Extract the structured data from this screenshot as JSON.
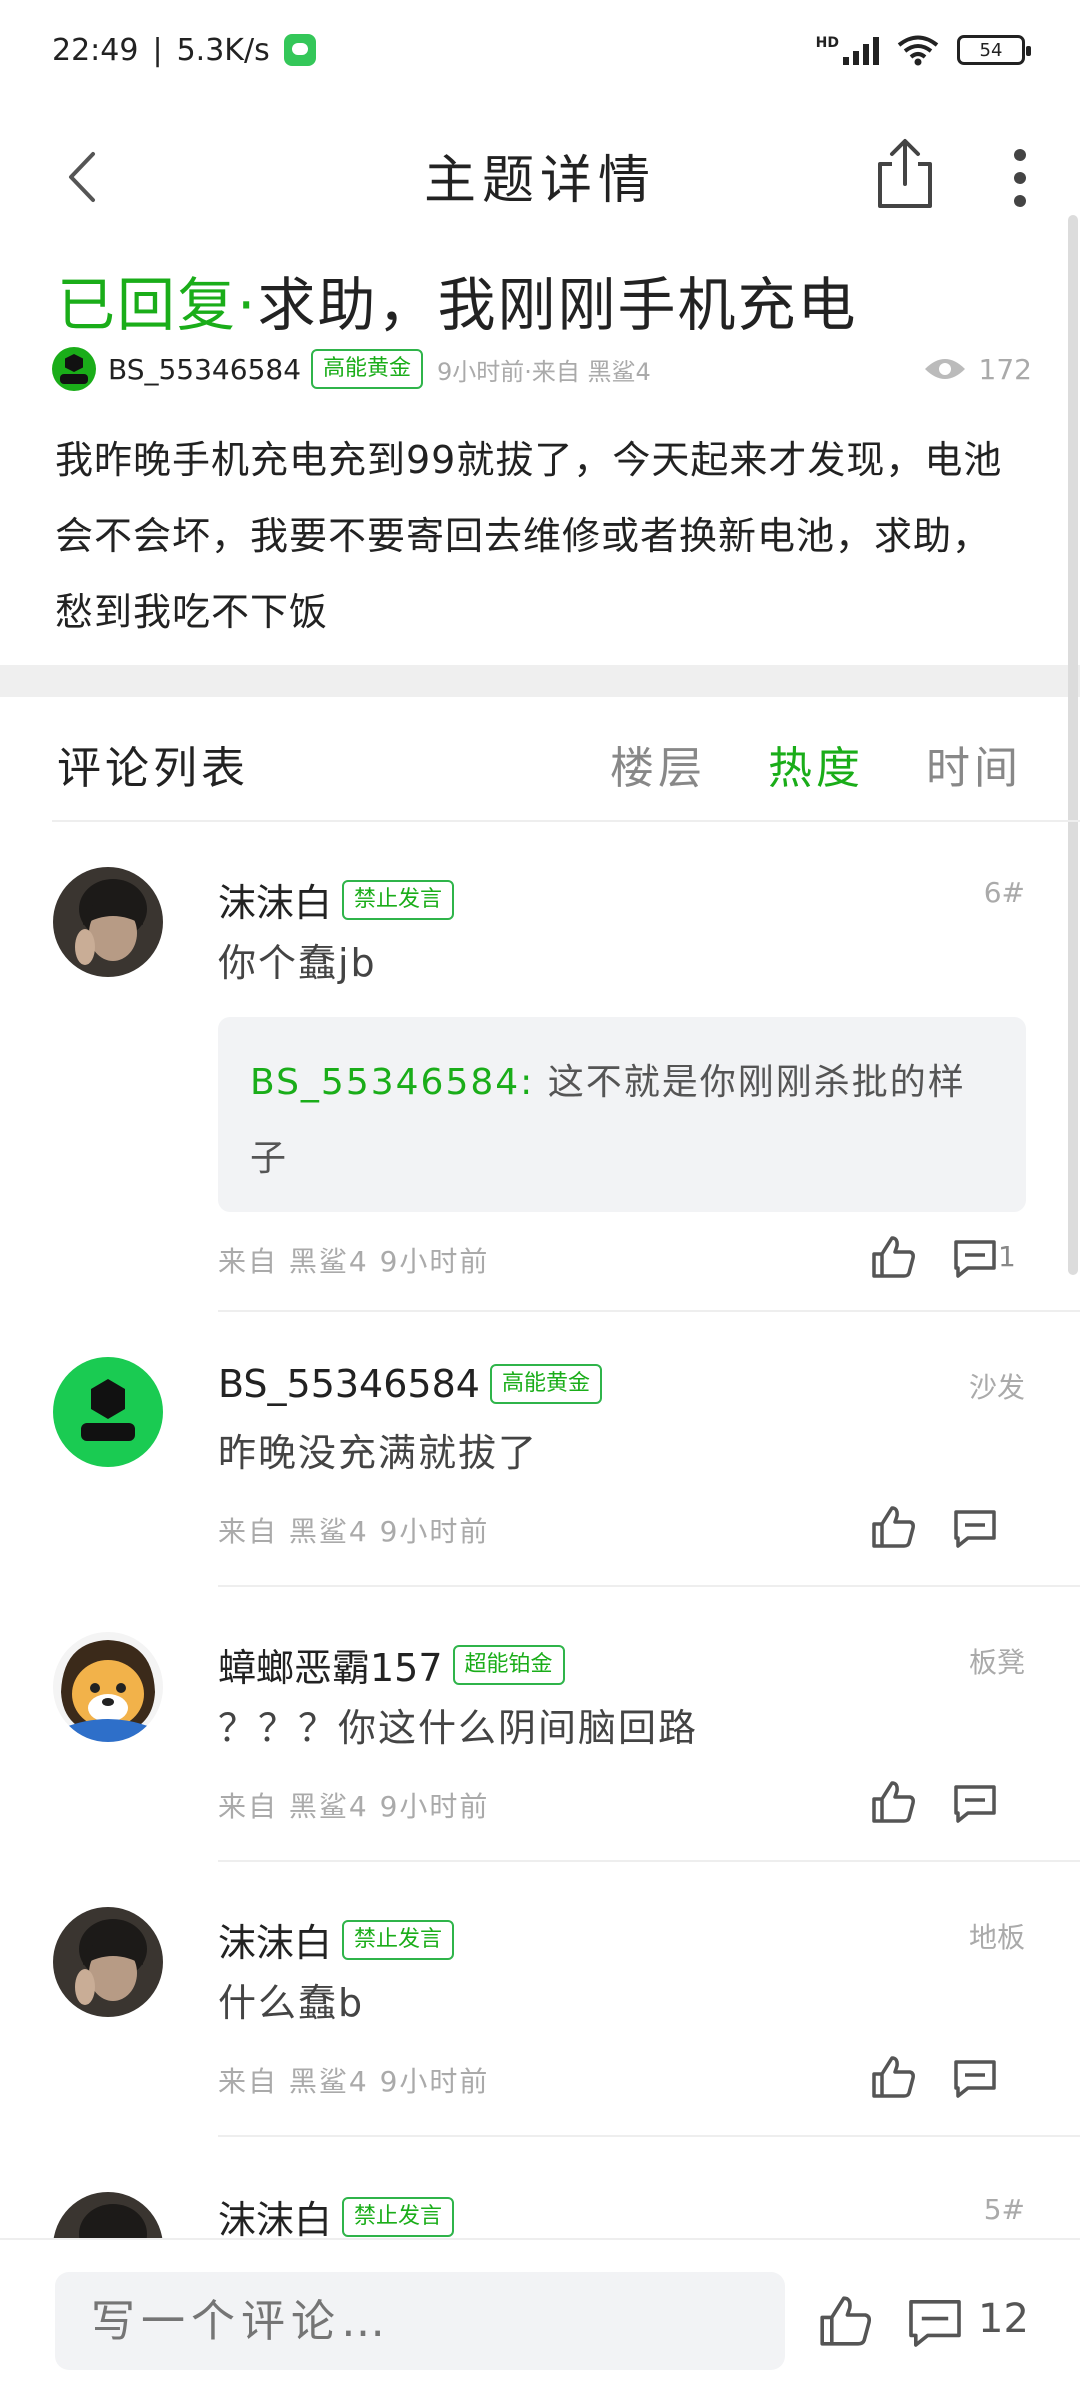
{
  "status_bar": {
    "time": "22:49",
    "net_speed": "5.3K/s",
    "hd_label": "HD",
    "battery": "54"
  },
  "header": {
    "title": "主题详情"
  },
  "post": {
    "status_label": "已回复·",
    "title": "求助，我刚刚手机充电",
    "author": "BS_55346584",
    "author_badge": "高能黄金",
    "meta": "9小时前·来自 黑鲨4",
    "views": "172",
    "body": "我昨晚手机充电充到99就拔了，今天起来才发现，电池会不会坏，我要不要寄回去维修或者换新电池，求助，愁到我吃不下饭"
  },
  "comments_header": {
    "title": "评论列表",
    "tabs": [
      {
        "label": "楼层",
        "active": false
      },
      {
        "label": "热度",
        "active": true
      },
      {
        "label": "时间",
        "active": false
      }
    ]
  },
  "comments": [
    {
      "name": "沫沫白",
      "badge": "禁止发言",
      "floor": "6#",
      "text": "你个蠢jb",
      "quote_user": "BS_55346584:",
      "quote_text": " 这不就是你刚刚杀批的样子",
      "footer": "来自 黑鲨4 9小时前",
      "reply_count": "1"
    },
    {
      "name": "BS_55346584",
      "badge": "高能黄金",
      "floor": "沙发",
      "text": "昨晚没充满就拔了",
      "footer": "来自 黑鲨4 9小时前"
    },
    {
      "name": "蟑螂恶霸157",
      "badge": "超能铂金",
      "floor": "板凳",
      "text": "？？？你这什么阴间脑回路",
      "footer": "来自 黑鲨4 9小时前"
    },
    {
      "name": "沫沫白",
      "badge": "禁止发言",
      "floor": "地板",
      "text": "什么蠢b",
      "footer": "来自 黑鲨4 9小时前"
    },
    {
      "name": "沫沫白",
      "badge": "禁止发言",
      "floor": "5#"
    }
  ],
  "bottom_bar": {
    "input_placeholder": "写一个评论…",
    "comment_count": "12"
  },
  "colors": {
    "accent": "#1aad19",
    "badge_border": "#2fb44a",
    "muted": "#aaaaaa",
    "quote_bg": "#f2f3f5"
  },
  "icons": [
    "back-icon",
    "share-icon",
    "more-icon",
    "eye-icon",
    "thumb-up-icon",
    "reply-icon",
    "wifi-icon",
    "signal-icon",
    "battery-icon"
  ]
}
